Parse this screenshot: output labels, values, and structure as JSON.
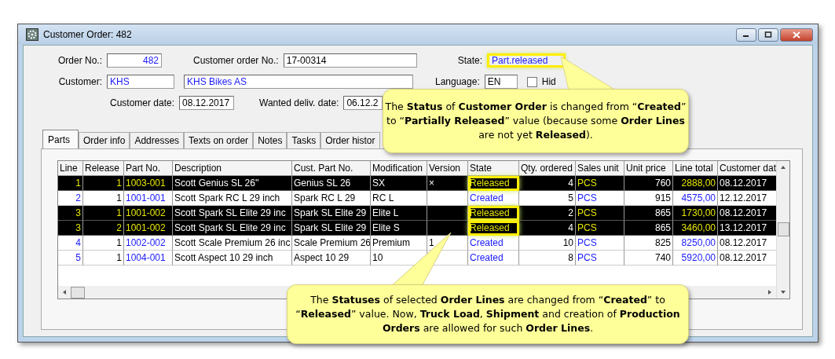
{
  "window": {
    "title": "Customer Order: 482"
  },
  "header": {
    "order_no_label": "Order No.:",
    "order_no": "482",
    "customer_order_no_label": "Customer order No.:",
    "customer_order_no": "17-00314",
    "state_label": "State:",
    "state": "Part.released",
    "state_highlighted": true,
    "customer_label": "Customer:",
    "customer_code": "KHS",
    "customer_name": "KHS Bikes AS",
    "language_label": "Language:",
    "language": "EN",
    "hide_closed": {
      "label": "Hid",
      "checked": false
    },
    "customer_date_label": "Customer date:",
    "customer_date": "08.12.2017",
    "wanted_date_label": "Wanted deliv. date:",
    "wanted_date": "06.12.2"
  },
  "tabs": [
    {
      "label": "Parts",
      "selected": true
    },
    {
      "label": "Order info",
      "selected": false
    },
    {
      "label": "Addresses",
      "selected": false
    },
    {
      "label": "Texts on order",
      "selected": false
    },
    {
      "label": "Notes",
      "selected": false
    },
    {
      "label": "Tasks",
      "selected": false
    },
    {
      "label": "Order histor",
      "selected": false
    }
  ],
  "table": {
    "columns": [
      "Line",
      "Release",
      "Part No.",
      "Description",
      "Cust. Part No.",
      "Modification",
      "Version",
      "State",
      "Qty. ordered",
      "Sales unit",
      "Unit price",
      "Line total",
      "Customer dat"
    ],
    "rows": [
      {
        "selected": true,
        "state_highlighted": true,
        "cells": [
          "1",
          "1",
          "1003-001",
          "Scott Genius SL 26''",
          "Genius SL 26",
          "SX",
          "×",
          "Released",
          "4",
          "PCS",
          "760",
          "2888,00",
          "08.12.2017"
        ]
      },
      {
        "selected": false,
        "state_highlighted": false,
        "cells": [
          "2",
          "1",
          "1001-001",
          "Scott Spark RC L 29 inch",
          "Spark RC L 29",
          "RC L",
          "",
          "Created",
          "5",
          "PCS",
          "915",
          "4575,00",
          "12.12.2017"
        ]
      },
      {
        "selected": true,
        "state_highlighted": true,
        "cells": [
          "3",
          "1",
          "1001-002",
          "Scott Spark SL Elite 29 inc",
          "Spark SL Elite 29",
          "Elite L",
          "",
          "Released",
          "2",
          "PCS",
          "865",
          "1730,00",
          "08.12.2017"
        ]
      },
      {
        "selected": true,
        "state_highlighted": true,
        "cells": [
          "3",
          "2",
          "1001-002",
          "Scott Spark SL Elite 29 inc",
          "Spark SL Elite 29",
          "Elite S",
          "",
          "Released",
          "4",
          "PCS",
          "865",
          "3460,00",
          "13.12.2017"
        ]
      },
      {
        "selected": false,
        "state_highlighted": false,
        "cells": [
          "4",
          "1",
          "1002-002",
          "Scott Scale Premium 26 inc",
          "Scale Premium 26",
          "Premium",
          "1",
          "Created",
          "10",
          "PCS",
          "825",
          "8250,00",
          "08.12.2017"
        ]
      },
      {
        "selected": false,
        "state_highlighted": false,
        "cells": [
          "5",
          "1",
          "1004-001",
          "Scott Aspect 10 29 inch",
          "Aspect 10 29",
          "10",
          "",
          "Created",
          "8",
          "PCS",
          "740",
          "5920,00",
          "08.12.2017"
        ]
      }
    ]
  },
  "callouts": [
    {
      "text": "The **Status** of **Customer Order** is changed from “**Created**” to “**Partially Released**” value (because some **Order Lines** are not yet **Released**)."
    },
    {
      "text": "The **Statuses** of selected **Order Lines** are changed from “**Created**” to “**Released**” value.  Now, **Truck Load**, **Shipment** and creation of **Production  Orders** are allowed for such **Order Lines**."
    }
  ]
}
